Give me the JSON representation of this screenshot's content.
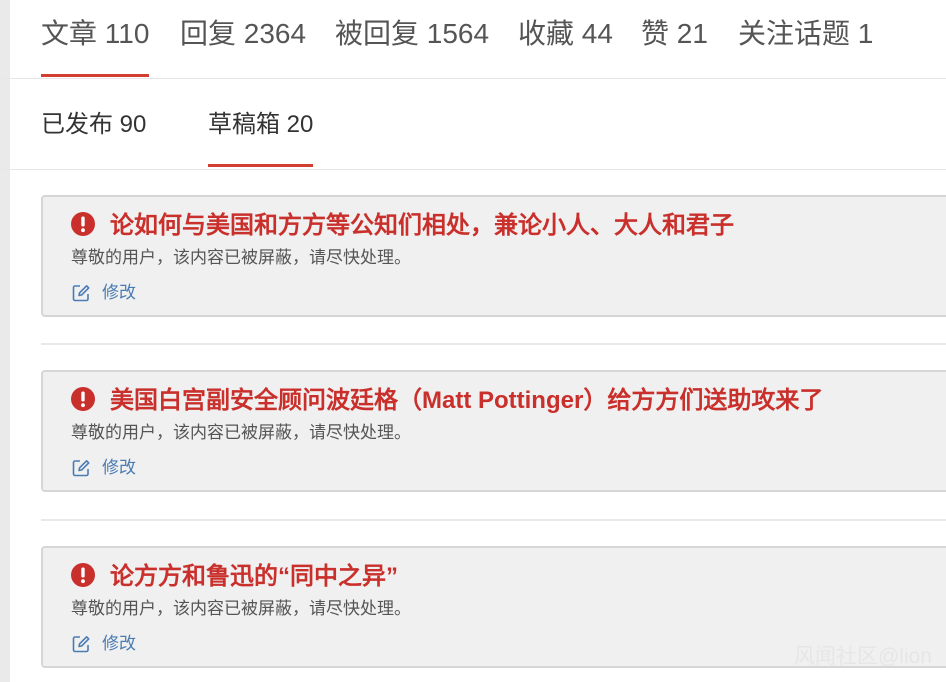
{
  "primary_tabs": [
    {
      "label": "文章 110",
      "active": true
    },
    {
      "label": "回复 2364",
      "active": false
    },
    {
      "label": "被回复 1564",
      "active": false
    },
    {
      "label": "收藏 44",
      "active": false
    },
    {
      "label": "赞 21",
      "active": false
    },
    {
      "label": "关注话题 1",
      "active": false
    }
  ],
  "secondary_tabs": [
    {
      "label": "已发布 90",
      "active": false
    },
    {
      "label": "草稿箱 20",
      "active": true
    }
  ],
  "articles": [
    {
      "title": "论如何与美国和方方等公知们相处，兼论小人、大人和君子",
      "notice": "尊敬的用户，该内容已被屏蔽，请尽快处理。",
      "edit_label": "修改"
    },
    {
      "title": "美国白宫副安全顾问波廷格（Matt Pottinger）给方方们送助攻来了",
      "notice": "尊敬的用户，该内容已被屏蔽，请尽快处理。",
      "edit_label": "修改"
    },
    {
      "title": "论方方和鲁迅的“同中之异”",
      "notice": "尊敬的用户，该内容已被屏蔽，请尽快处理。",
      "edit_label": "修改"
    }
  ],
  "watermark": "风闻社区@lion",
  "icons": {
    "alert": "exclamation-circle-icon",
    "edit": "edit-square-icon"
  },
  "colors": {
    "accent": "#d23f31",
    "title": "#c9302c",
    "link": "#4a7cb3",
    "card_bg": "#f0f0f0"
  }
}
